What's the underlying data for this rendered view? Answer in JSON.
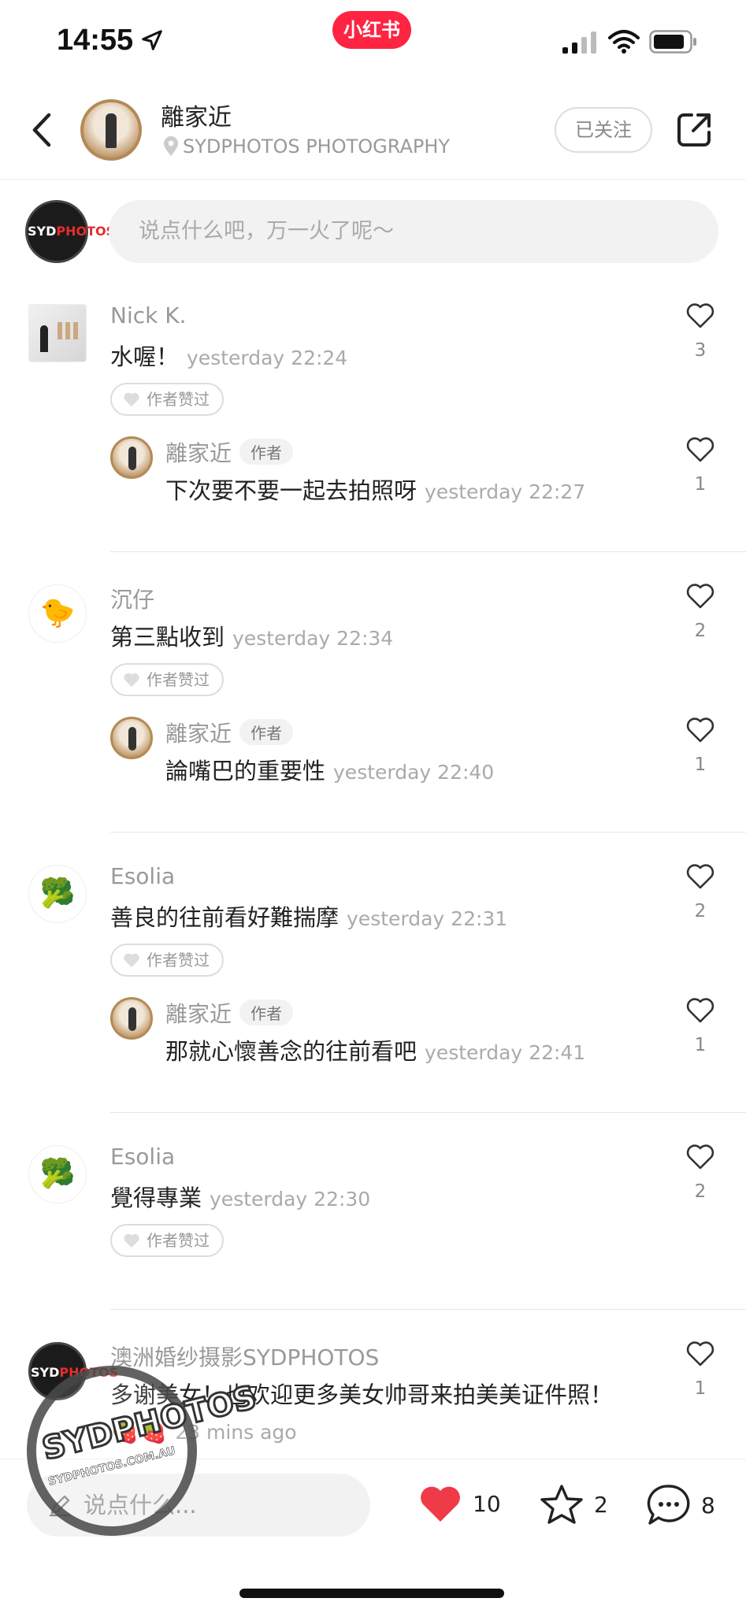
{
  "status_bar": {
    "time": "14:55",
    "brand": "小红书"
  },
  "header": {
    "title": "離家近",
    "location": "SYDPHOTOS PHOTOGRAPHY",
    "follow_label": "已关注"
  },
  "composer": {
    "placeholder": "说点什么吧，万一火了呢～"
  },
  "comments": [
    {
      "user": "Nick K.",
      "text": "水喔！",
      "time": "yesterday 22:24",
      "liked_label": "作者赞过",
      "likes": "3",
      "reply": {
        "user": "離家近",
        "tag": "作者",
        "text": "下次要不要一起去拍照呀",
        "time": "yesterday 22:27",
        "likes": "1"
      }
    },
    {
      "user": "沉仔",
      "text": "第三點收到",
      "time": "yesterday 22:34",
      "liked_label": "作者赞过",
      "likes": "2",
      "reply": {
        "user": "離家近",
        "tag": "作者",
        "text": "論嘴巴的重要性",
        "time": "yesterday 22:40",
        "likes": "1"
      }
    },
    {
      "user": "Esolia",
      "text": "善良的往前看好難揣摩",
      "time": "yesterday 22:31",
      "liked_label": "作者赞过",
      "likes": "2",
      "reply": {
        "user": "離家近",
        "tag": "作者",
        "text": "那就心懷善念的往前看吧",
        "time": "yesterday 22:41",
        "likes": "1"
      }
    },
    {
      "user": "Esolia",
      "text": "覺得專業",
      "time": "yesterday 22:30",
      "liked_label": "作者赞过",
      "likes": "2"
    },
    {
      "user": "澳洲婚纱摄影SYDPHOTOS",
      "text": "多谢美女！也欢迎更多美女帅哥来拍美美证件照！",
      "time": "23 mins ago",
      "likes": "1"
    }
  ],
  "bottom_bar": {
    "placeholder": "说点什么...",
    "likes": "10",
    "stars": "2",
    "comments": "8"
  },
  "watermark": {
    "logo": "SYDPHOTOS",
    "site": "SYDPHOTOS.COM.AU"
  },
  "colors": {
    "accent": "#ff2442",
    "like_red": "#ef3b47"
  }
}
